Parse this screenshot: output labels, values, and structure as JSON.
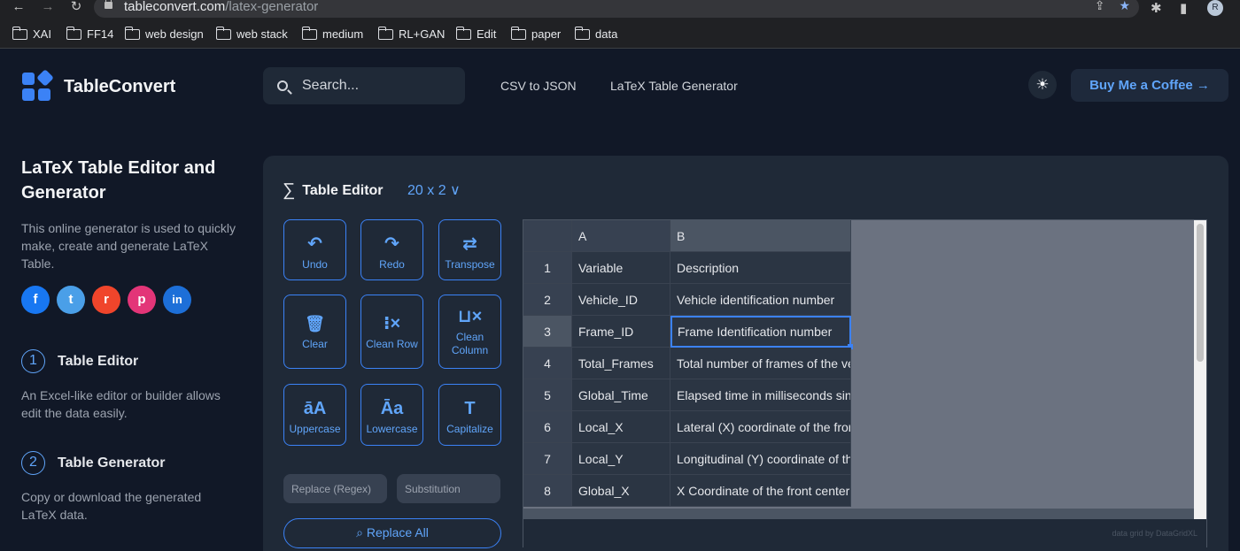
{
  "browser": {
    "url_domain": "tableconvert.com",
    "url_path": "/latex-generator",
    "profile_initial": "R",
    "bookmarks": [
      "XAI",
      "FF14",
      "web design",
      "web stack",
      "medium",
      "RL+GAN",
      "Edit",
      "paper",
      "data"
    ]
  },
  "header": {
    "brand": "TableConvert",
    "search_placeholder": "Search...",
    "nav": [
      "CSV to JSON",
      "LaTeX Table Generator"
    ],
    "coffee_label": "Buy Me a Coffee →"
  },
  "sidebar": {
    "title": "LaTeX Table Editor and Generator",
    "description": "This online generator is used to quickly make, create and generate LaTeX Table.",
    "social": [
      {
        "glyph": "f",
        "color": "#1877f2"
      },
      {
        "glyph": "t",
        "color": "#4a9fe8"
      },
      {
        "glyph": "r",
        "color": "#f0452b"
      },
      {
        "glyph": "p",
        "color": "#e33578"
      },
      {
        "glyph": "in",
        "color": "#1d6fd8"
      }
    ],
    "steps": [
      {
        "num": "1",
        "title": "Table Editor",
        "desc": "An Excel-like editor or builder allows edit the data easily."
      },
      {
        "num": "2",
        "title": "Table Generator",
        "desc": "Copy or download the generated LaTeX data."
      }
    ]
  },
  "editor": {
    "title": "Table Editor",
    "dimensions": "20 x 2 ∨",
    "tools": [
      {
        "icon": "↶",
        "label": "Undo"
      },
      {
        "icon": "↷",
        "label": "Redo"
      },
      {
        "icon": "⇄",
        "label": "Transpose"
      },
      {
        "icon": "🗑",
        "label": "Clear"
      },
      {
        "icon": "⁝×",
        "label": "Clean Row"
      },
      {
        "icon": "⊔×",
        "label": "Clean Column"
      },
      {
        "icon": "āA",
        "label": "Uppercase"
      },
      {
        "icon": "Āa",
        "label": "Lowercase"
      },
      {
        "icon": "T",
        "label": "Capitalize"
      }
    ],
    "replace_placeholder": "Replace (Regex)",
    "substitution_placeholder": "Substitution",
    "replace_all_label": "⌕ Replace All"
  },
  "grid": {
    "columns": [
      "A",
      "B"
    ],
    "rows": [
      {
        "num": "1",
        "a": "Variable",
        "b": "Description"
      },
      {
        "num": "2",
        "a": "Vehicle_ID",
        "b": "Vehicle identification number"
      },
      {
        "num": "3",
        "a": "Frame_ID",
        "b": "Frame Identification number"
      },
      {
        "num": "4",
        "a": "Total_Frames",
        "b": "Total number of frames of the ve"
      },
      {
        "num": "5",
        "a": "Global_Time",
        "b": "Elapsed time in milliseconds sin"
      },
      {
        "num": "6",
        "a": "Local_X",
        "b": "Lateral (X) coordinate of the fron"
      },
      {
        "num": "7",
        "a": "Local_Y",
        "b": "Longitudinal (Y) coordinate of th"
      },
      {
        "num": "8",
        "a": "Global_X",
        "b": "X Coordinate of the front center"
      }
    ],
    "credit": "data grid by DataGridXL"
  }
}
